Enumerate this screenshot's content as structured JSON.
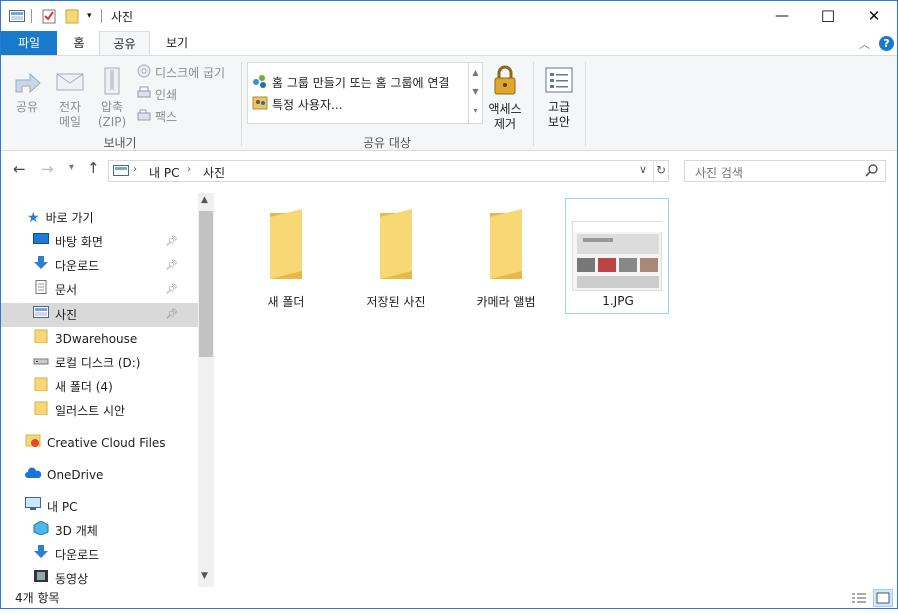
{
  "window": {
    "title": "사진",
    "minimize": "—",
    "maximize": "☐",
    "close": "✕"
  },
  "tabs": [
    "파일",
    "홈",
    "공유",
    "보기"
  ],
  "ribbon": {
    "send": {
      "share": "공유",
      "email_1": "전자",
      "email_2": "메일",
      "zip_1": "압축",
      "zip_2": "(ZIP)",
      "burn": "디스크에 굽기",
      "print": "인쇄",
      "fax": "팩스",
      "group": "보내기"
    },
    "share_with": {
      "homegroup": "홈 그룹 만들기 또는 홈 그룹에 연결",
      "specific": "특정 사용자...",
      "group": "공유 대상"
    },
    "remove_access_1": "액세스",
    "remove_access_2": "제거",
    "advanced_1": "고급",
    "advanced_2": "보안"
  },
  "address": {
    "root": "내 PC",
    "current": "사진",
    "search_placeholder": "사진 검색"
  },
  "nav": {
    "quick": "바로 가기",
    "items": [
      {
        "label": "바탕 화면",
        "pinned": true
      },
      {
        "label": "다운로드",
        "pinned": true
      },
      {
        "label": "문서",
        "pinned": true
      },
      {
        "label": "사진",
        "pinned": true
      },
      {
        "label": "3Dwarehouse"
      },
      {
        "label": "로컬 디스크 (D:)"
      },
      {
        "label": "새 폴더 (4)"
      },
      {
        "label": "일러스트 시안"
      }
    ],
    "cc": "Creative Cloud Files",
    "onedrive": "OneDrive",
    "pc": "내 PC",
    "pc_items": [
      "3D 개체",
      "다운로드",
      "동영상"
    ]
  },
  "files": [
    {
      "name": "새 폴더",
      "type": "folder"
    },
    {
      "name": "저장된 사진",
      "type": "folder"
    },
    {
      "name": "카메라 앨범",
      "type": "folder"
    },
    {
      "name": "1.JPG",
      "type": "image"
    }
  ],
  "status": {
    "count": "4개 항목"
  },
  "colors": {
    "accent": "#1979ca",
    "selection": "#cce8ff",
    "folder": "#f8d775"
  }
}
